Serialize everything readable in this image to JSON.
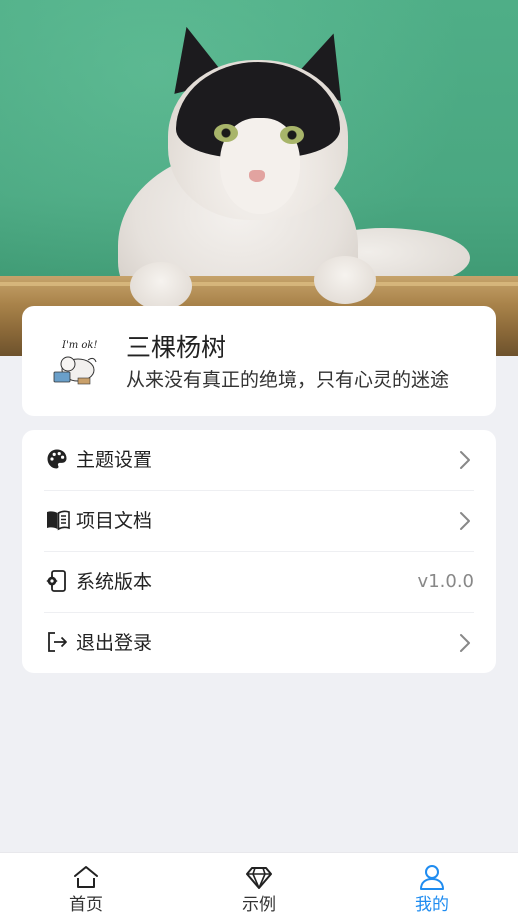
{
  "profile": {
    "name": "三棵杨树",
    "motto": "从来没有真正的绝境，只有心灵的迷途",
    "avatar_text": "I'm ok!"
  },
  "menu": {
    "items": [
      {
        "label": "主题设置",
        "icon": "palette-icon",
        "trailing": "chevron-right-icon"
      },
      {
        "label": "项目文档",
        "icon": "book-icon",
        "trailing": "chevron-right-icon"
      },
      {
        "label": "系统版本",
        "icon": "phone-settings-icon",
        "value": "v1.0.0"
      },
      {
        "label": "退出登录",
        "icon": "logout-icon",
        "trailing": "chevron-right-icon"
      }
    ]
  },
  "tabbar": {
    "tabs": [
      {
        "label": "首页",
        "icon": "home-icon"
      },
      {
        "label": "示例",
        "icon": "diamond-icon"
      },
      {
        "label": "我的",
        "icon": "user-icon",
        "active": true
      }
    ],
    "active_color": "#1f8cf0"
  },
  "colors": {
    "background": "#eff0f4",
    "card": "#ffffff",
    "banner_green": "#4fae87"
  }
}
